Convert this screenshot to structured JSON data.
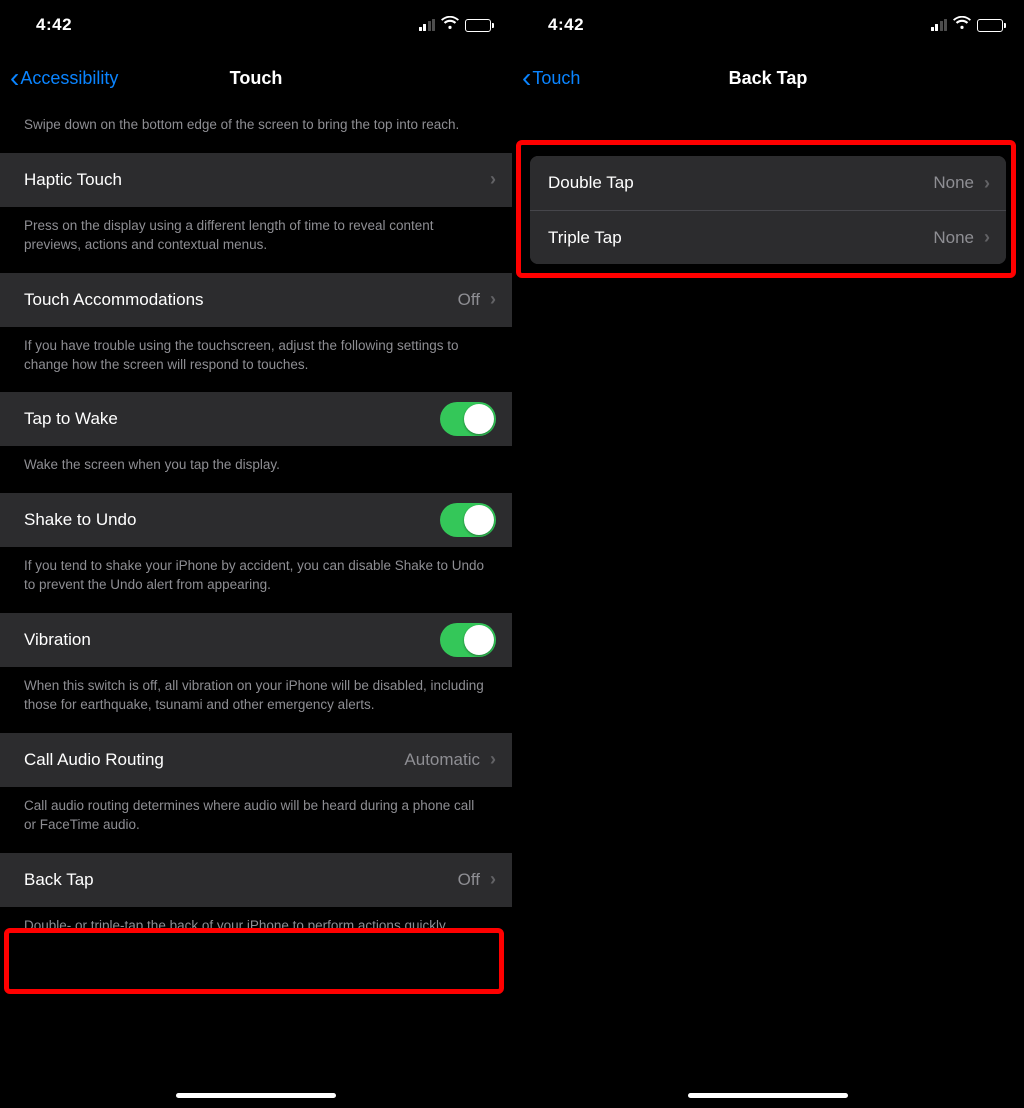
{
  "left": {
    "status": {
      "time": "4:42"
    },
    "nav": {
      "back": "Accessibility",
      "title": "Touch"
    },
    "reachability_footer": "Swipe down on the bottom edge of the screen to bring the top into reach.",
    "haptic": {
      "label": "Haptic Touch",
      "footer": "Press on the display using a different length of time to reveal content previews, actions and contextual menus."
    },
    "accom": {
      "label": "Touch Accommodations",
      "value": "Off",
      "footer": "If you have trouble using the touchscreen, adjust the following settings to change how the screen will respond to touches."
    },
    "tap_wake": {
      "label": "Tap to Wake",
      "footer": "Wake the screen when you tap the display."
    },
    "shake": {
      "label": "Shake to Undo",
      "footer": "If you tend to shake your iPhone by accident, you can disable Shake to Undo to prevent the Undo alert from appearing."
    },
    "vibration": {
      "label": "Vibration",
      "footer": "When this switch is off, all vibration on your iPhone will be disabled, including those for earthquake, tsunami and other emergency alerts."
    },
    "call_routing": {
      "label": "Call Audio Routing",
      "value": "Automatic",
      "footer": "Call audio routing determines where audio will be heard during a phone call or FaceTime audio."
    },
    "back_tap": {
      "label": "Back Tap",
      "value": "Off",
      "footer": "Double- or triple-tap the back of your iPhone to perform actions quickly."
    }
  },
  "right": {
    "status": {
      "time": "4:42"
    },
    "nav": {
      "back": "Touch",
      "title": "Back Tap"
    },
    "double": {
      "label": "Double Tap",
      "value": "None"
    },
    "triple": {
      "label": "Triple Tap",
      "value": "None"
    }
  }
}
